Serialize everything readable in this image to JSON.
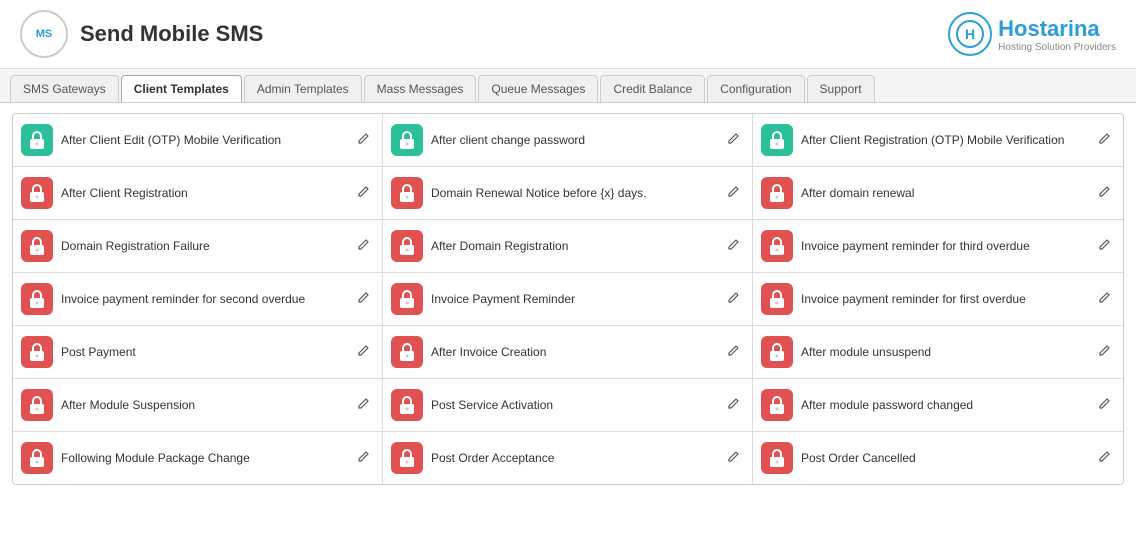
{
  "header": {
    "logo_text": "MS",
    "title": "Send Mobile SMS",
    "brand_icon": "H",
    "brand_name": "Hostarina",
    "brand_sub": "Hosting Solution Providers"
  },
  "tabs": [
    {
      "label": "SMS Gateways",
      "active": false
    },
    {
      "label": "Client Templates",
      "active": true
    },
    {
      "label": "Admin Templates",
      "active": false
    },
    {
      "label": "Mass Messages",
      "active": false
    },
    {
      "label": "Queue Messages",
      "active": false
    },
    {
      "label": "Credit Balance",
      "active": false
    },
    {
      "label": "Configuration",
      "active": false
    },
    {
      "label": "Support",
      "active": false
    }
  ],
  "templates": [
    {
      "label": "After Client Edit (OTP) Mobile Verification",
      "status": "green"
    },
    {
      "label": "After client change password",
      "status": "green"
    },
    {
      "label": "After Client Registration (OTP) Mobile Verification",
      "status": "green"
    },
    {
      "label": "After Client Registration",
      "status": "red"
    },
    {
      "label": "Domain Renewal Notice before {x} days.",
      "status": "red"
    },
    {
      "label": "After domain renewal",
      "status": "red"
    },
    {
      "label": "Domain Registration Failure",
      "status": "red"
    },
    {
      "label": "After Domain Registration",
      "status": "red"
    },
    {
      "label": "Invoice payment reminder for third overdue",
      "status": "red"
    },
    {
      "label": "Invoice payment reminder for second overdue",
      "status": "red"
    },
    {
      "label": "Invoice Payment Reminder",
      "status": "red"
    },
    {
      "label": "Invoice payment reminder for first overdue",
      "status": "red"
    },
    {
      "label": "Post Payment",
      "status": "red"
    },
    {
      "label": "After Invoice Creation",
      "status": "red"
    },
    {
      "label": "After module unsuspend",
      "status": "red"
    },
    {
      "label": "After Module Suspension",
      "status": "red"
    },
    {
      "label": "Post Service Activation",
      "status": "red"
    },
    {
      "label": "After module password changed",
      "status": "red"
    },
    {
      "label": "Following Module Package Change",
      "status": "red"
    },
    {
      "label": "Post Order Acceptance",
      "status": "red"
    },
    {
      "label": "Post Order Cancelled",
      "status": "red"
    }
  ]
}
